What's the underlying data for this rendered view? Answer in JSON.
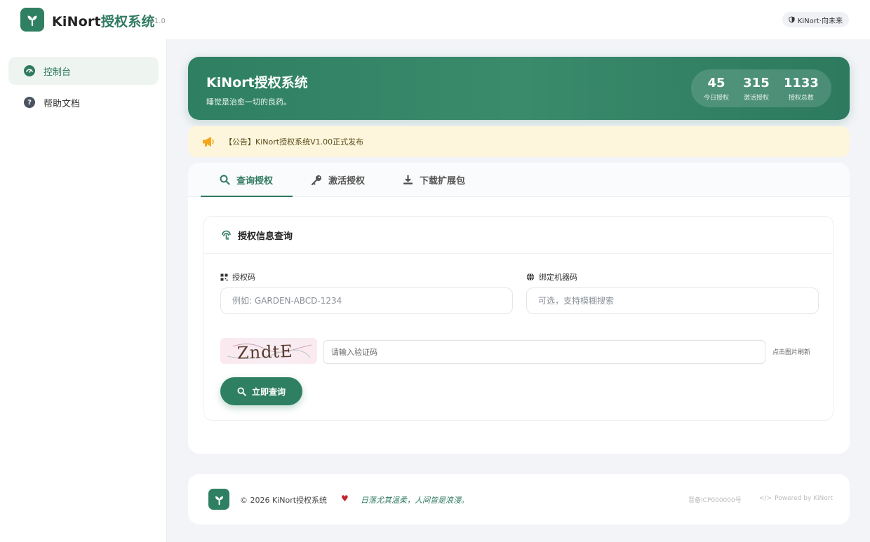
{
  "app": {
    "brand_latin": "KiNort",
    "brand_cn": "授权系统",
    "version": "v1.0",
    "badge": "KiNort·向未来"
  },
  "sidebar": {
    "items": [
      {
        "label": "控制台",
        "icon": "dashboard-icon",
        "active": true
      },
      {
        "label": "帮助文档",
        "icon": "help-icon",
        "active": false
      }
    ]
  },
  "hero": {
    "title": "KiNort授权系统",
    "subtitle": "睡觉是治愈一切的良药。",
    "stats": [
      {
        "value": "45",
        "label": "今日授权"
      },
      {
        "value": "315",
        "label": "激活授权"
      },
      {
        "value": "1133",
        "label": "授权总数"
      }
    ]
  },
  "notice": {
    "text": "【公告】KiNort授权系统V1.00正式发布",
    "icon": "megaphone-icon"
  },
  "tabs": [
    {
      "label": "查询授权",
      "icon": "search-icon",
      "active": true
    },
    {
      "label": "激活授权",
      "icon": "key-icon",
      "active": false
    },
    {
      "label": "下载扩展包",
      "icon": "download-icon",
      "active": false
    }
  ],
  "query_panel": {
    "title": "授权信息查询",
    "auth_code_label": "授权码",
    "auth_code_placeholder": "例如: GARDEN-ABCD-1234",
    "machine_label": "绑定机器码",
    "machine_placeholder": "可选，支持模糊搜索",
    "captcha_text": "ZndtE",
    "captcha_placeholder": "请输入验证码",
    "refresh_hint": "点击图片刷新",
    "submit_label": "立即查询"
  },
  "footer": {
    "copyright": "© 2026 KiNort授权系统",
    "slogan": "日落尤其温柔，人间皆是浪漫。",
    "icp": "晋备ICP000000号",
    "powered": "Powered by KiNort"
  },
  "colors": {
    "accent": "#2f8063",
    "notice_bg": "#fdf6dc",
    "heart": "#c0282d"
  }
}
